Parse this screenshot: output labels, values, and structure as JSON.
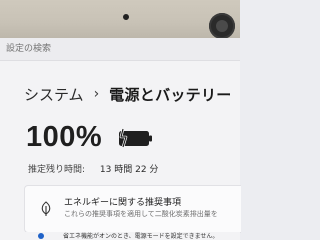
{
  "search": {
    "placeholder": "設定の検索"
  },
  "breadcrumb": {
    "parent": "システム",
    "separator": "›",
    "current": "電源とバッテリー"
  },
  "battery": {
    "percent_text": "100%",
    "level": 1.0,
    "remaining_label": "推定残り時間:",
    "remaining_value": "13 時間 22 分"
  },
  "recommendation": {
    "title": "エネルギーに関する推奨事項",
    "description": "これらの推奨事項を適用して二酸化炭素排出量を"
  },
  "notice": {
    "text": "省エネ機能がオンのとき、電源モードを設定できません。"
  },
  "colors": {
    "accent": "#1f62c8",
    "text": "#1f1f1f",
    "muted": "#6e6e6e"
  }
}
